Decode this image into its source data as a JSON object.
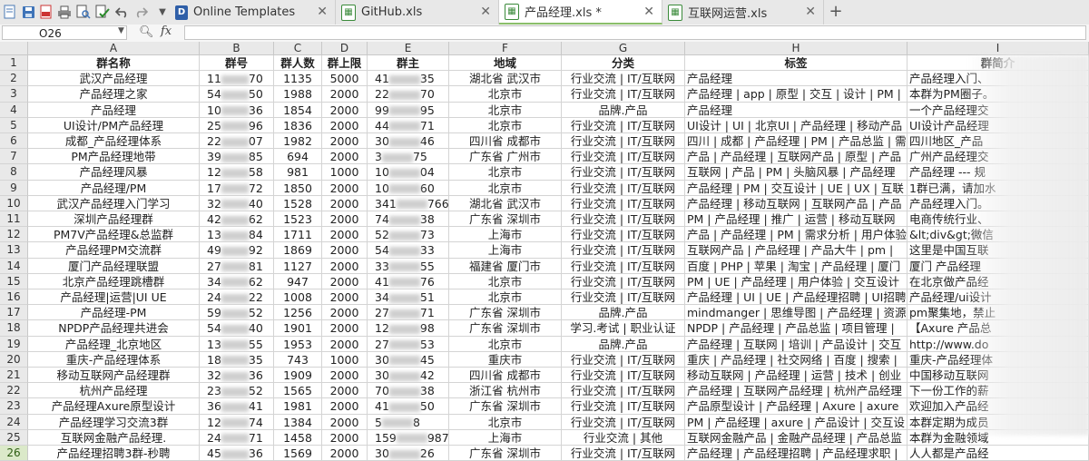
{
  "toolbar": {
    "icons": [
      "document-icon",
      "save-icon",
      "export-pdf-icon",
      "print-icon",
      "print-preview-icon",
      "spellcheck-icon",
      "undo-icon",
      "redo-icon",
      "dropdown-icon"
    ]
  },
  "tabs": [
    {
      "label": "Online Templates",
      "icon": "templates-icon",
      "active": false
    },
    {
      "label": "GitHub.xls",
      "icon": "spreadsheet-icon",
      "active": false
    },
    {
      "label": "产品经理.xls *",
      "icon": "spreadsheet-icon",
      "active": true
    },
    {
      "label": "互联网运营.xls",
      "icon": "spreadsheet-icon",
      "active": false
    }
  ],
  "new_tab_label": "+",
  "formula_bar": {
    "cell_ref": "O26",
    "fx_label": "fx",
    "value": ""
  },
  "columns": [
    "A",
    "B",
    "C",
    "D",
    "E",
    "F",
    "G",
    "H",
    "I"
  ],
  "headers": [
    "群名称",
    "群号",
    "群人数",
    "群上限",
    "群主",
    "地域",
    "分类",
    "标签",
    "群简介"
  ],
  "rows": [
    {
      "n": "2",
      "a": "武汉产品经理",
      "b": "11",
      "b2": "70",
      "c": "1135",
      "d": "5000",
      "e": "41",
      "e2": "35",
      "f": "湖北省 武汉市",
      "g": "行业交流 | IT/互联网",
      "h": "产品经理",
      "i": "产品经理入门、"
    },
    {
      "n": "3",
      "a": "产品经理之家",
      "b": "54",
      "b2": "50",
      "c": "1988",
      "d": "2000",
      "e": "22",
      "e2": "70",
      "f": "北京市",
      "g": "行业交流 | IT/互联网",
      "h": "产品经理 | app | 原型 | 交互 | 设计 | PM |",
      "i": "本群为PM圈子。"
    },
    {
      "n": "4",
      "a": "产品经理",
      "b": "10",
      "b2": "36",
      "c": "1854",
      "d": "2000",
      "e": "99",
      "e2": "95",
      "f": "北京市",
      "g": "品牌.产品",
      "h": "产品经理",
      "i": "一个产品经理交"
    },
    {
      "n": "5",
      "a": "UI设计/PM产品经理",
      "b": "25",
      "b2": "96",
      "c": "1836",
      "d": "2000",
      "e": "44",
      "e2": "71",
      "f": "北京市",
      "g": "行业交流 | IT/互联网",
      "h": "UI设计 | UI | 北京UI | 产品经理 | 移动产品",
      "i": "UI设计产品经理"
    },
    {
      "n": "6",
      "a": "成都_产品经理体系",
      "b": "22",
      "b2": "07",
      "c": "1982",
      "d": "2000",
      "e": "30",
      "e2": "46",
      "f": "四川省 成都市",
      "g": "行业交流 | IT/互联网",
      "h": "四川 | 成都 | 产品经理 | PM | 产品总监 | 需",
      "i": "四川地区_产品"
    },
    {
      "n": "7",
      "a": "PM产品经理地带",
      "b": "39",
      "b2": "85",
      "c": "694",
      "d": "2000",
      "e": "3",
      "e2": "75",
      "f": "广东省 广州市",
      "g": "行业交流 | IT/互联网",
      "h": "产品 | 产品经理 | 互联网产品 | 原型 | 产品",
      "i": "广州产品经理交"
    },
    {
      "n": "8",
      "a": "产品经理风暴",
      "b": "12",
      "b2": "58",
      "c": "981",
      "d": "1000",
      "e": "10",
      "e2": "04",
      "f": "北京市",
      "g": "行业交流 | IT/互联网",
      "h": "互联网 | 产品 | PM | 头脑风暴 | 产品经理",
      "i": "产品经理 --- 规"
    },
    {
      "n": "9",
      "a": "产品经理/PM",
      "b": "17",
      "b2": "72",
      "c": "1850",
      "d": "2000",
      "e": "10",
      "e2": "60",
      "f": "北京市",
      "g": "行业交流 | IT/互联网",
      "h": "产品经理 | PM | 交互设计 | UE | UX | 互联",
      "i": "1群已满，请加水"
    },
    {
      "n": "10",
      "a": "武汉产品经理入门学习",
      "b": "32",
      "b2": "40",
      "c": "1528",
      "d": "2000",
      "e": "341",
      "e2": "766",
      "f": "湖北省 武汉市",
      "g": "行业交流 | IT/互联网",
      "h": "产品经理 | 移动互联网 | 互联网产品 | 产品",
      "i": "产品经理入门。"
    },
    {
      "n": "11",
      "a": "深圳产品经理群",
      "b": "42",
      "b2": "62",
      "c": "1523",
      "d": "2000",
      "e": "74",
      "e2": "38",
      "f": "广东省 深圳市",
      "g": "行业交流 | IT/互联网",
      "h": "PM | 产品经理 | 推广 | 运营 | 移动互联网",
      "i": "电商传统行业、"
    },
    {
      "n": "12",
      "a": "PM7V产品经理&总监群",
      "b": "13",
      "b2": "84",
      "c": "1711",
      "d": "2000",
      "e": "52",
      "e2": "73",
      "f": "上海市",
      "g": "行业交流 | IT/互联网",
      "h": "产品 | 产品经理 | PM | 需求分析 | 用户体验",
      "i": "&lt;div&gt;微信"
    },
    {
      "n": "13",
      "a": "产品经理PM交流群",
      "b": "49",
      "b2": "92",
      "c": "1869",
      "d": "2000",
      "e": "54",
      "e2": "33",
      "f": "上海市",
      "g": "行业交流 | IT/互联网",
      "h": "互联网产品 | 产品经理 | 产品大牛 | pm |",
      "i": "这里是中国互联"
    },
    {
      "n": "14",
      "a": "厦门产品经理联盟",
      "b": "27",
      "b2": "81",
      "c": "1127",
      "d": "2000",
      "e": "33",
      "e2": "55",
      "f": "福建省 厦门市",
      "g": "行业交流 | IT/互联网",
      "h": "百度 | PHP | 苹果 | 淘宝 | 产品经理 | 厦门",
      "i": "厦门 产品经理"
    },
    {
      "n": "15",
      "a": "北京产品经理跳槽群",
      "b": "34",
      "b2": "62",
      "c": "947",
      "d": "2000",
      "e": "41",
      "e2": "76",
      "f": "北京市",
      "g": "行业交流 | IT/互联网",
      "h": "PM | UE | 产品经理 | 用户体验 | 交互设计",
      "i": "在北京做产品经"
    },
    {
      "n": "16",
      "a": "产品经理|运营|UI UE",
      "b": "24",
      "b2": "22",
      "c": "1008",
      "d": "2000",
      "e": "34",
      "e2": "51",
      "f": "北京市",
      "g": "行业交流 | IT/互联网",
      "h": "产品经理 | UI | UE | 产品经理招聘 | UI招聘",
      "i": "产品经理/ui设计"
    },
    {
      "n": "17",
      "a": "产品经理-PM",
      "b": "59",
      "b2": "52",
      "c": "1256",
      "d": "2000",
      "e": "27",
      "e2": "71",
      "f": "广东省 深圳市",
      "g": "品牌.产品",
      "h": "mindmanger | 思维导图 | 产品经理 | 资源",
      "i": "pm聚集地，禁止"
    },
    {
      "n": "18",
      "a": "NPDP产品经理共进会",
      "b": "54",
      "b2": "40",
      "c": "1901",
      "d": "2000",
      "e": "12",
      "e2": "98",
      "f": "广东省 深圳市",
      "g": "学习.考试 | 职业认证",
      "h": "NPDP | 产品经理 | 产品总监 | 项目管理 |",
      "i": "【Axure 产品总"
    },
    {
      "n": "19",
      "a": "产品经理_北京地区",
      "b": "13",
      "b2": "55",
      "c": "1953",
      "d": "2000",
      "e": "27",
      "e2": "53",
      "f": "北京市",
      "g": "品牌.产品",
      "h": "产品经理 | 互联网 | 培训 | 产品设计 | 交互",
      "i": "http://www.do"
    },
    {
      "n": "20",
      "a": "重庆-产品经理体系",
      "b": "18",
      "b2": "35",
      "c": "743",
      "d": "1000",
      "e": "30",
      "e2": "45",
      "f": "重庆市",
      "g": "行业交流 | IT/互联网",
      "h": "重庆 | 产品经理 | 社交网络 | 百度 | 搜索 |",
      "i": "重庆-产品经理体"
    },
    {
      "n": "21",
      "a": "移动互联网产品经理群",
      "b": "32",
      "b2": "36",
      "c": "1909",
      "d": "2000",
      "e": "30",
      "e2": "42",
      "f": "四川省 成都市",
      "g": "行业交流 | IT/互联网",
      "h": "移动互联网 | 产品经理 | 运营 | 技术 | 创业",
      "i": "中国移动互联网"
    },
    {
      "n": "22",
      "a": "杭州产品经理",
      "b": "23",
      "b2": "52",
      "c": "1565",
      "d": "2000",
      "e": "70",
      "e2": "38",
      "f": "浙江省 杭州市",
      "g": "行业交流 | IT/互联网",
      "h": "产品经理 | 互联网产品经理 | 杭州产品经理",
      "i": "下一份工作的薪"
    },
    {
      "n": "23",
      "a": "产品经理Axure原型设计",
      "b": "36",
      "b2": "41",
      "c": "1981",
      "d": "2000",
      "e": "41",
      "e2": "50",
      "f": "广东省 深圳市",
      "g": "行业交流 | IT/互联网",
      "h": "产品原型设计 | 产品经理 | Axure | axure",
      "i": "欢迎加入产品经"
    },
    {
      "n": "24",
      "a": "产品经理学习交流3群",
      "b": "12",
      "b2": "74",
      "c": "1384",
      "d": "2000",
      "e": "5",
      "e2": "8",
      "f": "北京市",
      "g": "行业交流 | IT/互联网",
      "h": "PM | 产品经理 | axure | 产品设计 | 交互设",
      "i": "本群定期为成员"
    },
    {
      "n": "25",
      "a": "互联网金融产品经理.",
      "b": "24",
      "b2": "71",
      "c": "1458",
      "d": "2000",
      "e": "159",
      "e2": "987",
      "f": "上海市",
      "g": "行业交流 | 其他",
      "h": "互联网金融产品 | 金融产品经理 | 产品总监",
      "i": "本群为金融领域"
    },
    {
      "n": "26",
      "a": "产品经理招聘3群-秒聘",
      "b": "45",
      "b2": "36",
      "c": "1569",
      "d": "2000",
      "e": "30",
      "e2": "26",
      "f": "广东省 深圳市",
      "g": "行业交流 | IT/互联网",
      "h": "产品经理 | 产品经理招聘 | 产品经理求职 |",
      "i": "人人都是产品经"
    }
  ]
}
